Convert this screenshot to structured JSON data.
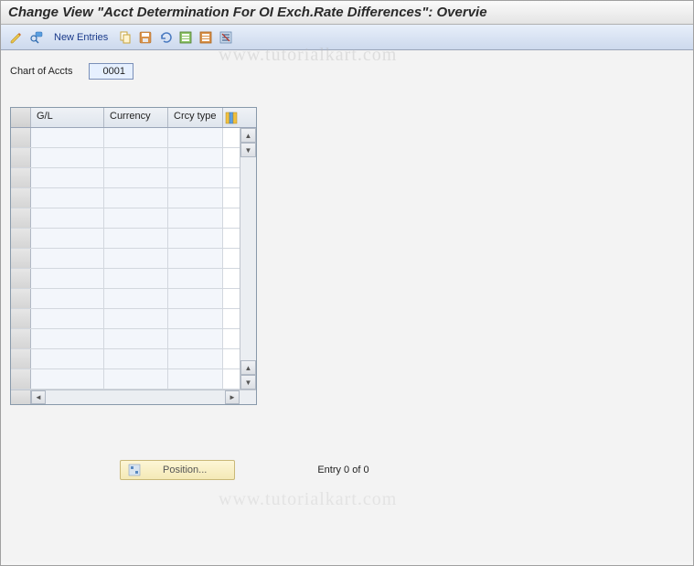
{
  "window": {
    "title": "Change View \"Acct Determination For OI Exch.Rate Differences\": Overvie"
  },
  "toolbar": {
    "new_entries_label": "New Entries"
  },
  "fields": {
    "chart_of_accts_label": "Chart of Accts",
    "chart_of_accts_value": "0001"
  },
  "grid": {
    "columns": {
      "gl": "G/L",
      "currency": "Currency",
      "crcy_type": "Crcy type"
    },
    "row_count": 13
  },
  "footer": {
    "position_label": "Position...",
    "entry_status": "Entry 0 of 0"
  },
  "watermark": "www.tutorialkart.com",
  "watermark2": "www.tutorialkart.com"
}
